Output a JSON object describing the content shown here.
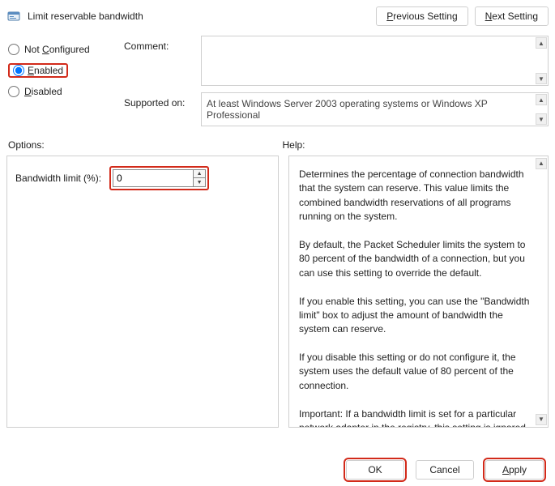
{
  "header": {
    "title": "Limit reservable bandwidth",
    "prev_label": "Previous Setting",
    "next_label": "Next Setting"
  },
  "radios": {
    "not_configured": "Not Configured",
    "enabled": "Enabled",
    "disabled": "Disabled",
    "selected": "enabled"
  },
  "fields": {
    "comment_label": "Comment:",
    "comment_value": "",
    "supported_label": "Supported on:",
    "supported_value": "At least Windows Server 2003 operating systems or Windows XP Professional"
  },
  "section_labels": {
    "options": "Options:",
    "help": "Help:"
  },
  "options": {
    "bandwidth_label": "Bandwidth limit (%):",
    "bandwidth_value": "0"
  },
  "help": {
    "p1": "Determines the percentage of connection bandwidth that the system can reserve. This value limits the combined bandwidth reservations of all programs running on the system.",
    "p2": "By default, the Packet Scheduler limits the system to 80 percent of the bandwidth of a connection, but you can use this setting to override the default.",
    "p3": "If you enable this setting, you can use the \"Bandwidth limit\" box to adjust the amount of bandwidth the system can reserve.",
    "p4": "If you disable this setting or do not configure it, the system uses the default value of 80 percent of the connection.",
    "p5": "Important: If a bandwidth limit is set for a particular network adapter in the registry, this setting is ignored when configuring that network adapter."
  },
  "footer": {
    "ok": "OK",
    "cancel": "Cancel",
    "apply": "Apply"
  }
}
